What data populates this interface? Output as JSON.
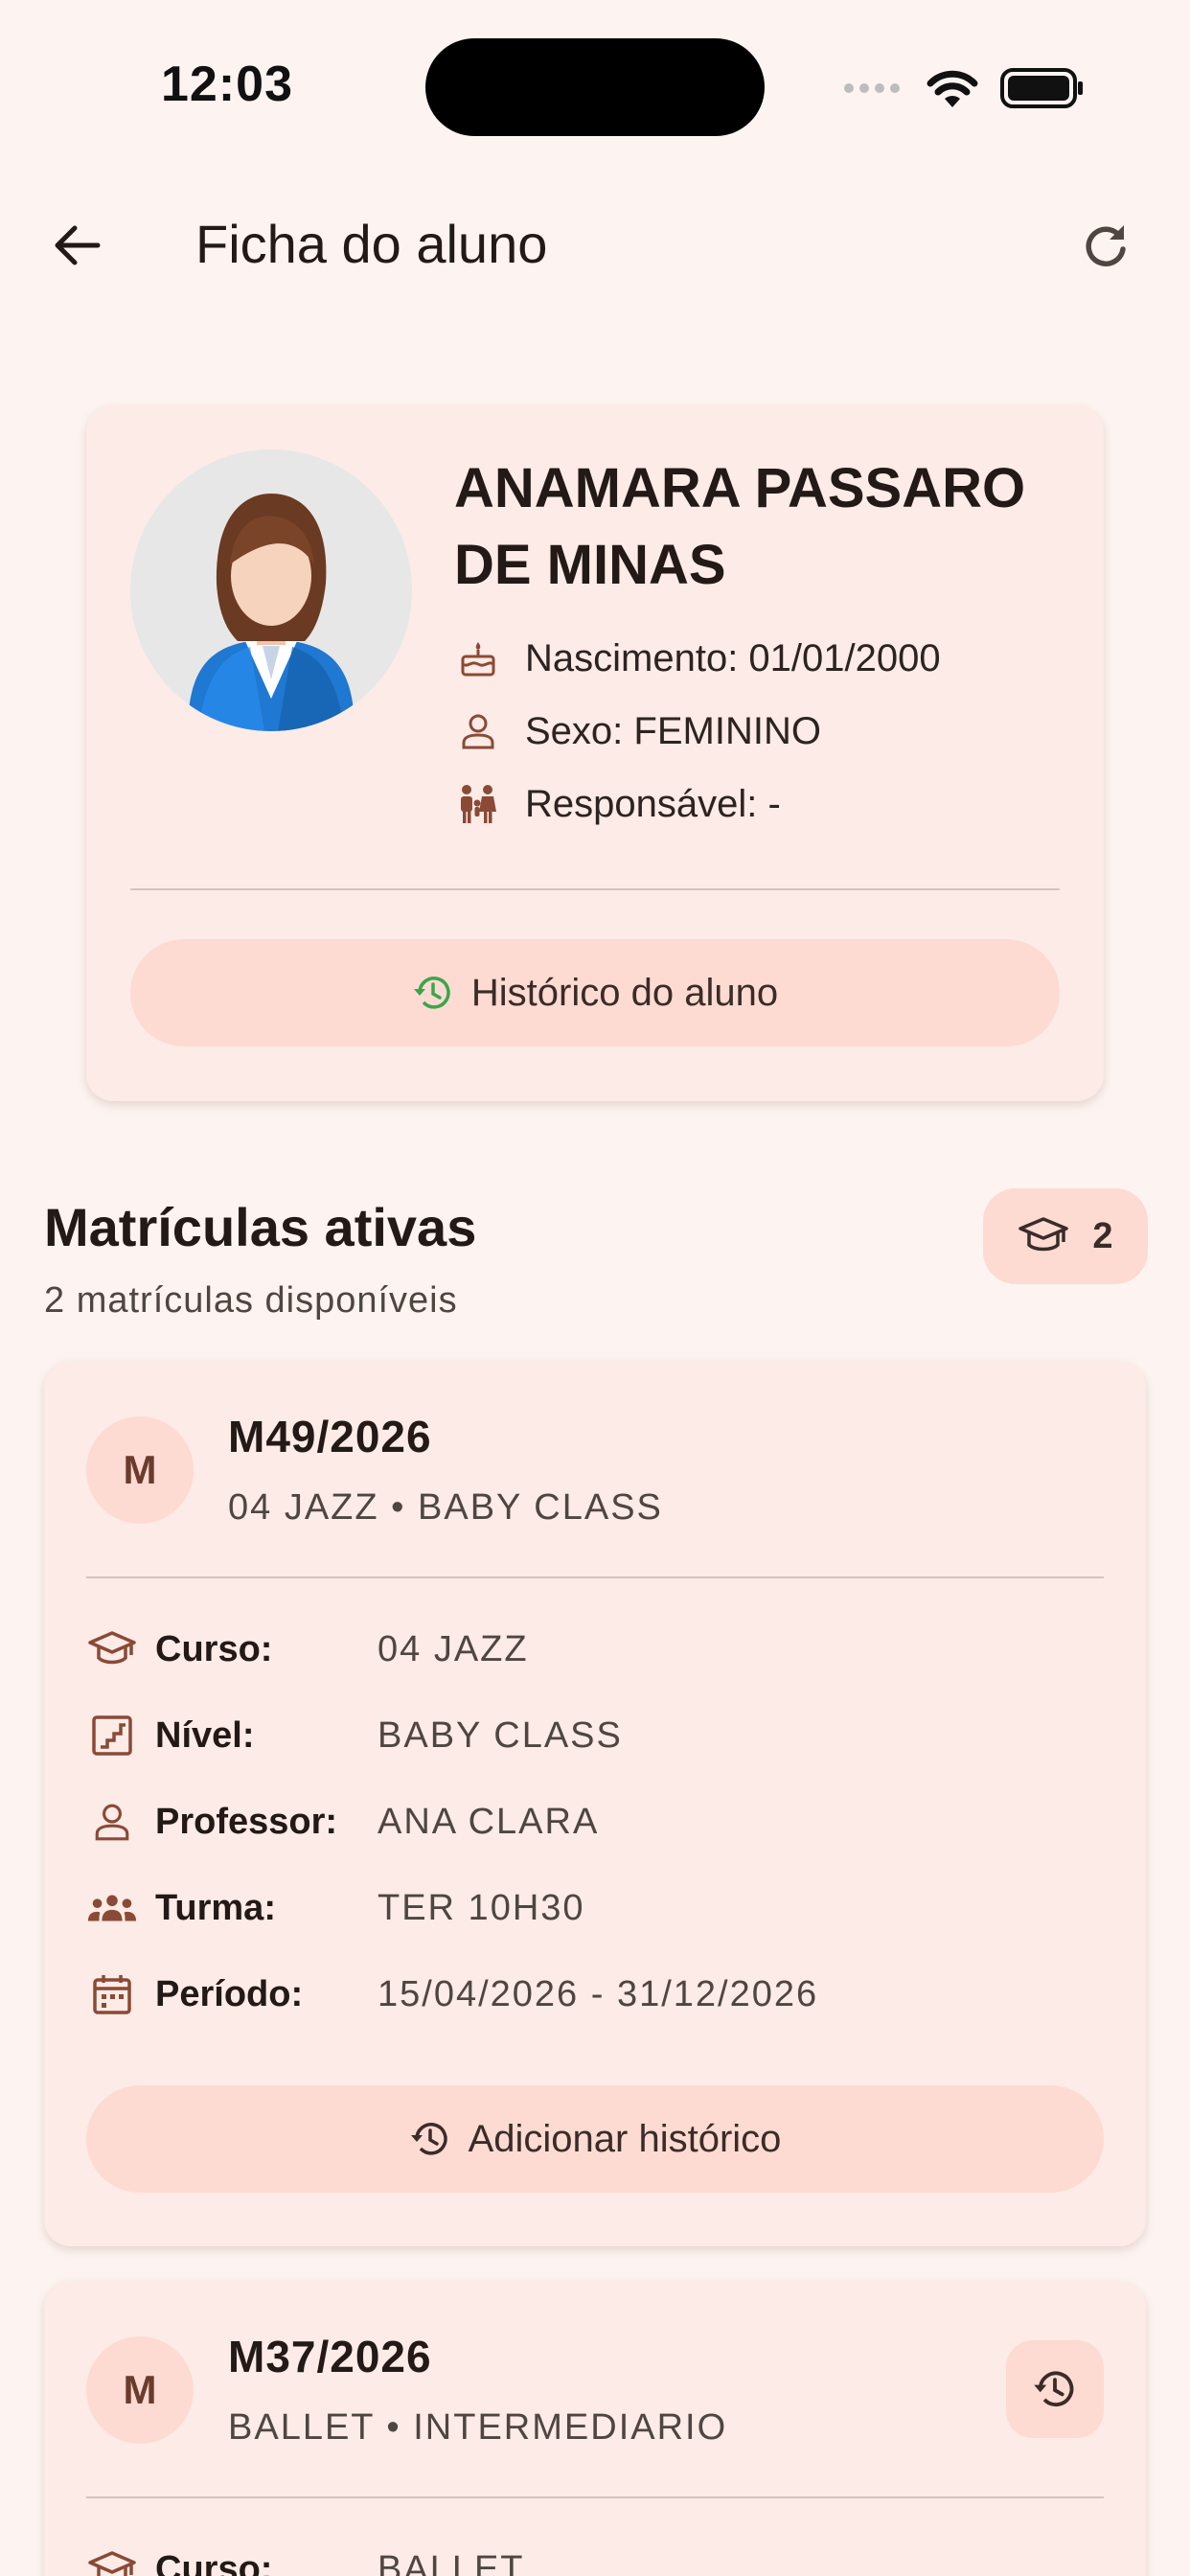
{
  "status_bar": {
    "time": "12:03"
  },
  "app_bar": {
    "title": "Ficha do aluno"
  },
  "profile": {
    "name": "ANAMARA PASSARO DE MINAS",
    "birth": "Nascimento: 01/01/2000",
    "sex": "Sexo: FEMININO",
    "guardian": "Responsável: -",
    "history_button": "Histórico do aluno"
  },
  "enrollments_section": {
    "title": "Matrículas ativas",
    "subtitle": "2 matrículas disponíveis",
    "count": "2"
  },
  "enrollments": [
    {
      "avatar_letter": "M",
      "code": "M49/2026",
      "subtitle": "04 JAZZ • BABY CLASS",
      "rows": [
        {
          "label": "Curso:",
          "value": "04 JAZZ"
        },
        {
          "label": "Nível:",
          "value": "BABY CLASS"
        },
        {
          "label": "Professor:",
          "value": "ANA CLARA"
        },
        {
          "label": "Turma:",
          "value": "TER 10H30"
        },
        {
          "label": "Período:",
          "value": "15/04/2026 - 31/12/2026"
        }
      ],
      "add_history_button": "Adicionar histórico"
    },
    {
      "avatar_letter": "M",
      "code": "M37/2026",
      "subtitle": "BALLET • INTERMEDIARIO",
      "rows": [
        {
          "label": "Curso:",
          "value": "BALLET"
        }
      ]
    }
  ],
  "colors": {
    "background": "#fdf4f1",
    "card": "#fcebe6",
    "accent_soft": "#fddbd2",
    "icon_brown": "#8a4a36",
    "history_green": "#3aa64a"
  }
}
